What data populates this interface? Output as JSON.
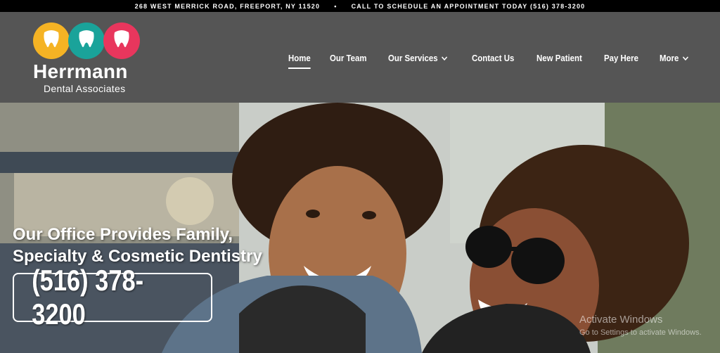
{
  "topbar": {
    "address": "268 WEST MERRICK ROAD, FREEPORT, NY 11520",
    "separator": "•",
    "call": "CALL TO SCHEDULE AN APPOINTMENT TODAY (516) 378-3200"
  },
  "logo": {
    "brand": "Herrmann",
    "sub": "Dental Associates",
    "colors": [
      "#f5b324",
      "#1aa39a",
      "#e8365d"
    ]
  },
  "nav": {
    "items": [
      {
        "label": "Home",
        "active": true
      },
      {
        "label": "Our Team"
      },
      {
        "label": "Our Services",
        "dropdown": true
      },
      {
        "label": "Contact Us"
      },
      {
        "label": "New Patient"
      },
      {
        "label": "Pay Here"
      },
      {
        "label": "More",
        "dropdown": true
      }
    ]
  },
  "hero": {
    "title_line1": "Our Office Provides Family,",
    "title_line2": "Specialty & Cosmetic Dentistry",
    "phone": "(516) 378-3200"
  },
  "watermark": {
    "line1": "Activate Windows",
    "line2": "Go to Settings to activate Windows."
  },
  "colors": {
    "header_bg": "#555555",
    "topbar_bg": "#000000"
  }
}
